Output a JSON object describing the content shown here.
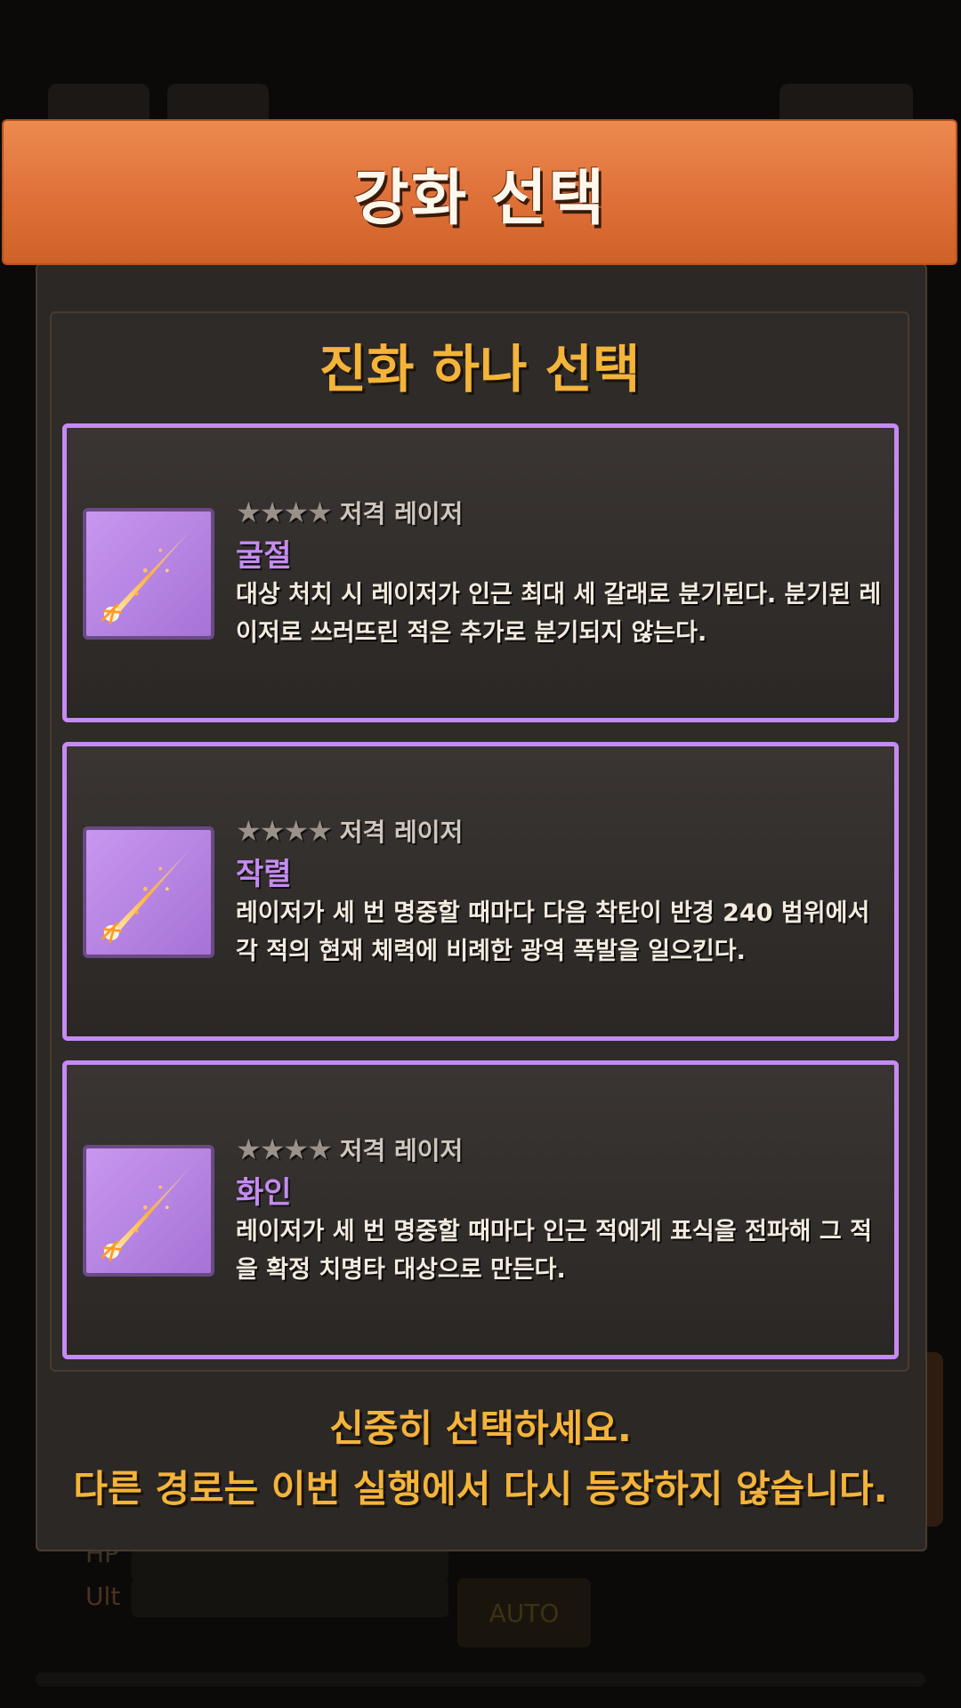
{
  "background": {
    "hp_label": "HP",
    "ult_label": "Ult",
    "auto_button": "AUTO"
  },
  "modal": {
    "title": "강화 선택",
    "subtitle": "진화 하나 선택",
    "cards": [
      {
        "stars": "★★★★",
        "category": "저격 레이저",
        "name": "굴절",
        "description": "대상 처치 시 레이저가 인근 최대 세 갈래로 분기된다. 분기된 레이저로 쓰러뜨린 적은 추가로 분기되지 않는다.",
        "icon": "laser-bolt-icon"
      },
      {
        "stars": "★★★★",
        "category": "저격 레이저",
        "name": "작렬",
        "description": "레이저가 세 번 명중할 때마다 다음 착탄이 반경 240 범위에서 각 적의 현재 체력에 비례한 광역 폭발을 일으킨다.",
        "icon": "laser-bolt-icon"
      },
      {
        "stars": "★★★★",
        "category": "저격 레이저",
        "name": "화인",
        "description": "레이저가 세 번 명중할 때마다 인근 적에게 표식을 전파해 그 적을 확정 치명타 대상으로 만든다.",
        "icon": "laser-bolt-icon"
      }
    ],
    "footer_line1": "신중히 선택하세요.",
    "footer_line2": "다른 경로는 이번 실행에서 다시 등장하지 않습니다."
  },
  "colors": {
    "accent_orange": "#de7038",
    "gold_text": "#f4b43a",
    "card_border": "#c58bf2"
  }
}
